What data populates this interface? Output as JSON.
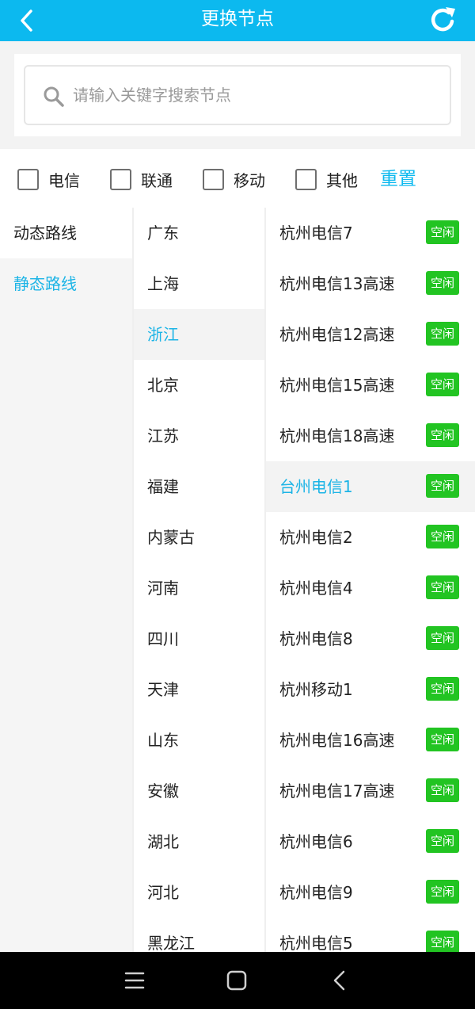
{
  "header": {
    "title": "更换节点"
  },
  "search": {
    "placeholder": "请输入关键字搜索节点",
    "value": ""
  },
  "filters": {
    "options": [
      "电信",
      "联通",
      "移动",
      "其他"
    ],
    "reset_label": "重置"
  },
  "route_types": [
    {
      "label": "动态路线",
      "active": false
    },
    {
      "label": "静态路线",
      "active": true
    }
  ],
  "regions": [
    "广东",
    "上海",
    "浙江",
    "北京",
    "江苏",
    "福建",
    "内蒙古",
    "河南",
    "四川",
    "天津",
    "山东",
    "安徽",
    "湖北",
    "河北",
    "黑龙江"
  ],
  "selected_region": "浙江",
  "nodes": [
    {
      "name": "杭州电信7",
      "status": "空闲"
    },
    {
      "name": "杭州电信13高速",
      "status": "空闲"
    },
    {
      "name": "杭州电信12高速",
      "status": "空闲"
    },
    {
      "name": "杭州电信15高速",
      "status": "空闲"
    },
    {
      "name": "杭州电信18高速",
      "status": "空闲"
    },
    {
      "name": "台州电信1",
      "status": "空闲"
    },
    {
      "name": "杭州电信2",
      "status": "空闲"
    },
    {
      "name": "杭州电信4",
      "status": "空闲"
    },
    {
      "name": "杭州电信8",
      "status": "空闲"
    },
    {
      "name": "杭州移动1",
      "status": "空闲"
    },
    {
      "name": "杭州电信16高速",
      "status": "空闲"
    },
    {
      "name": "杭州电信17高速",
      "status": "空闲"
    },
    {
      "name": "杭州电信6",
      "status": "空闲"
    },
    {
      "name": "杭州电信9",
      "status": "空闲"
    },
    {
      "name": "杭州电信5",
      "status": "空闲"
    }
  ],
  "selected_node": "台州电信1",
  "colors": {
    "accent": "#0cb9ef",
    "badge": "#22c422",
    "selected_text": "#1cb4e6"
  }
}
